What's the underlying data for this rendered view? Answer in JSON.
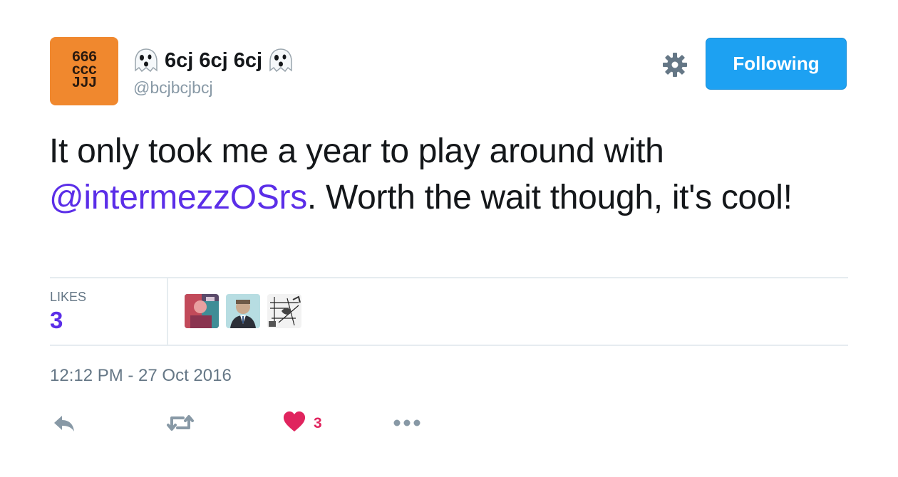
{
  "tweet": {
    "avatar_glyphs": [
      "666",
      "ccc",
      "JJJ"
    ],
    "display_name": "6cj 6cj 6cj",
    "handle": "@bcjbcjbcj",
    "follow_label": "Following",
    "text_before": "It only took me a year to play around with ",
    "mention": "@intermezzOSrs",
    "text_after": ". Worth the wait though, it's cool!",
    "timestamp": "12:12 PM - 27 Oct 2016"
  },
  "stats": {
    "likes_label": "LIKES",
    "likes_count": "3"
  },
  "actions": {
    "like_count": "3"
  },
  "icons": [
    "ghost-icon",
    "gear-icon",
    "reply-icon",
    "retweet-icon",
    "heart-icon",
    "more-icon"
  ],
  "colors": {
    "accent": "#1da1f2",
    "mention": "#5b2ee8",
    "like": "#e0245e",
    "avatar_bg": "#f0882e",
    "muted": "#8899a6"
  }
}
